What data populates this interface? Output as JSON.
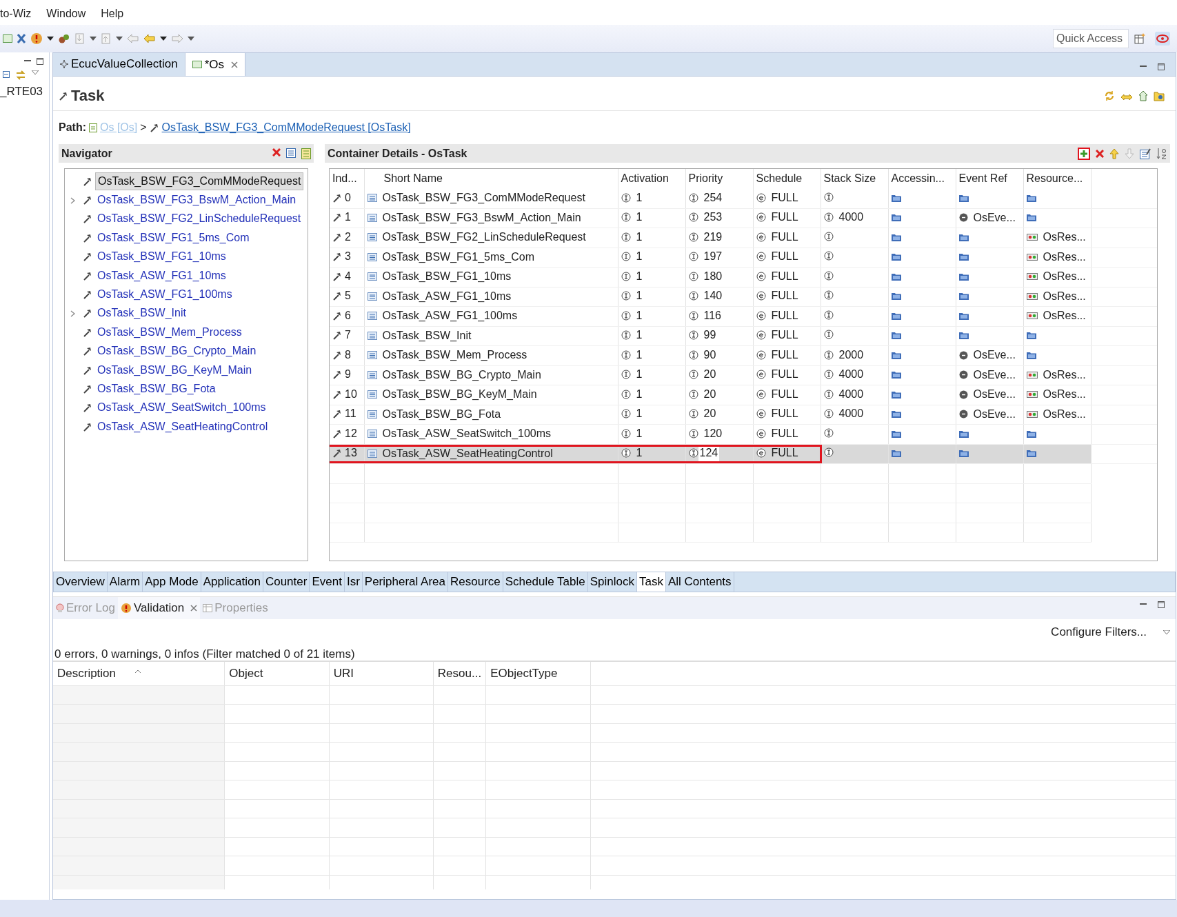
{
  "menu": [
    "to-Wiz",
    "Window",
    "Help"
  ],
  "quick_access": {
    "placeholder": "Quick Access"
  },
  "side_panel": {
    "item": "_RTE03"
  },
  "editor_tabs": [
    {
      "label": "EcucValueCollection",
      "selected": false,
      "closable": false
    },
    {
      "label": "*Os",
      "selected": true,
      "closable": true
    }
  ],
  "page_title": "Task",
  "path": {
    "label": "Path:",
    "separator": ">",
    "items": [
      {
        "text": "Os [Os]",
        "disabled": true
      },
      {
        "text": "OsTask_BSW_FG3_ComMModeRequest [OsTask]",
        "disabled": false
      }
    ]
  },
  "navigator": {
    "title": "Navigator",
    "items": [
      {
        "label": "OsTask_BSW_FG3_ComMModeRequest",
        "selected": true,
        "expandable": false
      },
      {
        "label": "OsTask_BSW_FG3_BswM_Action_Main",
        "selected": false,
        "expandable": true
      },
      {
        "label": "OsTask_BSW_FG2_LinScheduleRequest",
        "selected": false,
        "expandable": false
      },
      {
        "label": "OsTask_BSW_FG1_5ms_Com",
        "selected": false,
        "expandable": false
      },
      {
        "label": "OsTask_BSW_FG1_10ms",
        "selected": false,
        "expandable": false
      },
      {
        "label": "OsTask_ASW_FG1_10ms",
        "selected": false,
        "expandable": false
      },
      {
        "label": "OsTask_ASW_FG1_100ms",
        "selected": false,
        "expandable": false
      },
      {
        "label": "OsTask_BSW_Init",
        "selected": false,
        "expandable": true
      },
      {
        "label": "OsTask_BSW_Mem_Process",
        "selected": false,
        "expandable": false
      },
      {
        "label": "OsTask_BSW_BG_Crypto_Main",
        "selected": false,
        "expandable": false
      },
      {
        "label": "OsTask_BSW_BG_KeyM_Main",
        "selected": false,
        "expandable": false
      },
      {
        "label": "OsTask_BSW_BG_Fota",
        "selected": false,
        "expandable": false
      },
      {
        "label": "OsTask_ASW_SeatSwitch_100ms",
        "selected": false,
        "expandable": false
      },
      {
        "label": "OsTask_ASW_SeatHeatingControl",
        "selected": false,
        "expandable": false
      }
    ]
  },
  "details": {
    "title": "Container Details - OsTask",
    "add_highlighted": true,
    "columns": [
      "Ind...",
      "Short Name",
      "Activation",
      "Priority",
      "Schedule",
      "Stack Size",
      "Accessin...",
      "Event Ref",
      "Resource..."
    ],
    "rows": [
      {
        "index": "0",
        "short_name": "OsTask_BSW_FG3_ComMModeRequest",
        "activation": "1",
        "priority": "254",
        "schedule": "FULL",
        "selected": false,
        "highlighted": false,
        "editing": false
      },
      {
        "index": "1",
        "short_name": "OsTask_BSW_FG3_BswM_Action_Main",
        "activation": "1",
        "priority": "253",
        "schedule": "FULL",
        "stack_size": "4000",
        "event_ref": "OsEve...",
        "selected": false,
        "highlighted": false,
        "editing": false
      },
      {
        "index": "2",
        "short_name": "OsTask_BSW_FG2_LinScheduleRequest",
        "activation": "1",
        "priority": "219",
        "schedule": "FULL",
        "resource": "OsRes...",
        "selected": false,
        "highlighted": false,
        "editing": false
      },
      {
        "index": "3",
        "short_name": "OsTask_BSW_FG1_5ms_Com",
        "activation": "1",
        "priority": "197",
        "schedule": "FULL",
        "resource": "OsRes...",
        "selected": false,
        "highlighted": false,
        "editing": false
      },
      {
        "index": "4",
        "short_name": "OsTask_BSW_FG1_10ms",
        "activation": "1",
        "priority": "180",
        "schedule": "FULL",
        "resource": "OsRes...",
        "selected": false,
        "highlighted": false,
        "editing": false
      },
      {
        "index": "5",
        "short_name": "OsTask_ASW_FG1_10ms",
        "activation": "1",
        "priority": "140",
        "schedule": "FULL",
        "resource": "OsRes...",
        "selected": false,
        "highlighted": false,
        "editing": false
      },
      {
        "index": "6",
        "short_name": "OsTask_ASW_FG1_100ms",
        "activation": "1",
        "priority": "116",
        "schedule": "FULL",
        "resource": "OsRes...",
        "selected": false,
        "highlighted": false,
        "editing": false
      },
      {
        "index": "7",
        "short_name": "OsTask_BSW_Init",
        "activation": "1",
        "priority": "99",
        "schedule": "FULL",
        "selected": false,
        "highlighted": false,
        "editing": false
      },
      {
        "index": "8",
        "short_name": "OsTask_BSW_Mem_Process",
        "activation": "1",
        "priority": "90",
        "schedule": "FULL",
        "stack_size": "2000",
        "event_ref": "OsEve...",
        "selected": false,
        "highlighted": false,
        "editing": false
      },
      {
        "index": "9",
        "short_name": "OsTask_BSW_BG_Crypto_Main",
        "activation": "1",
        "priority": "20",
        "schedule": "FULL",
        "stack_size": "4000",
        "event_ref": "OsEve...",
        "resource": "OsRes...",
        "selected": false,
        "highlighted": false,
        "editing": false
      },
      {
        "index": "10",
        "short_name": "OsTask_BSW_BG_KeyM_Main",
        "activation": "1",
        "priority": "20",
        "schedule": "FULL",
        "stack_size": "4000",
        "event_ref": "OsEve...",
        "resource": "OsRes...",
        "selected": false,
        "highlighted": false,
        "editing": false
      },
      {
        "index": "11",
        "short_name": "OsTask_BSW_BG_Fota",
        "activation": "1",
        "priority": "20",
        "schedule": "FULL",
        "stack_size": "4000",
        "event_ref": "OsEve...",
        "resource": "OsRes...",
        "selected": false,
        "highlighted": false,
        "editing": false
      },
      {
        "index": "12",
        "short_name": "OsTask_ASW_SeatSwitch_100ms",
        "activation": "1",
        "priority": "120",
        "schedule": "FULL",
        "selected": false,
        "highlighted": false,
        "editing": false
      },
      {
        "index": "13",
        "short_name": "OsTask_ASW_SeatHeatingControl",
        "activation": "1",
        "priority": "124",
        "schedule": "FULL",
        "selected": true,
        "highlighted": true,
        "editing": true
      }
    ]
  },
  "page_tabs": [
    {
      "label": "Overview",
      "selected": false
    },
    {
      "label": "Alarm",
      "selected": false
    },
    {
      "label": "App Mode",
      "selected": false
    },
    {
      "label": "Application",
      "selected": false
    },
    {
      "label": "Counter",
      "selected": false
    },
    {
      "label": "Event",
      "selected": false
    },
    {
      "label": "Isr",
      "selected": false
    },
    {
      "label": "Peripheral Area",
      "selected": false
    },
    {
      "label": "Resource",
      "selected": false
    },
    {
      "label": "Schedule Table",
      "selected": false
    },
    {
      "label": "Spinlock",
      "selected": false
    },
    {
      "label": "Task",
      "selected": true
    },
    {
      "label": "All Contents",
      "selected": false
    }
  ],
  "validation": {
    "tabs": [
      {
        "kind": "error",
        "label": "Error Log",
        "selected": false,
        "closable": false
      },
      {
        "kind": "validation",
        "label": "Validation",
        "selected": true,
        "closable": true
      },
      {
        "kind": "properties",
        "label": "Properties",
        "selected": false,
        "closable": false
      }
    ],
    "configure": "Configure Filters...",
    "summary": "0 errors, 0 warnings, 0 infos (Filter matched 0 of 21 items)",
    "columns": [
      {
        "label": "Description",
        "sorted": true
      },
      {
        "label": "Object",
        "sorted": false
      },
      {
        "label": "URI",
        "sorted": false
      },
      {
        "label": "Resou...",
        "sorted": false
      },
      {
        "label": "EObjectType",
        "sorted": false
      }
    ]
  }
}
